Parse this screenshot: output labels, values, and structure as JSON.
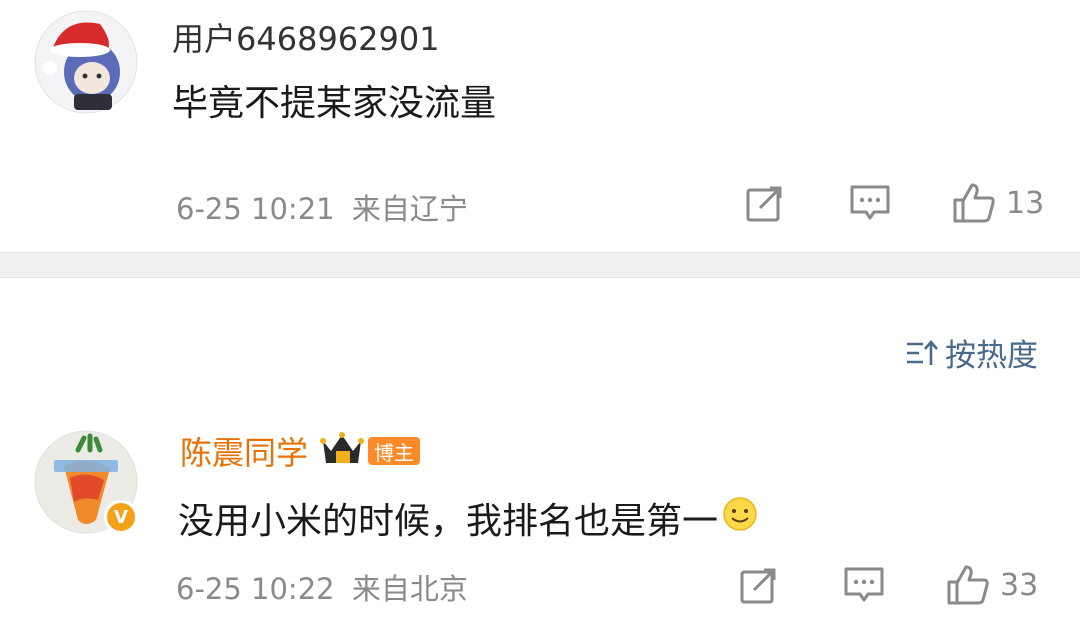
{
  "comments": [
    {
      "username": "用户6468962901",
      "content": "毕竟不提某家没流量",
      "timestamp": "6-25 10:21",
      "location": "来自辽宁",
      "likes": "13",
      "avatar_icon": "anime-avatar-santa-hat"
    },
    {
      "username": "陈震同学",
      "badge": "博主",
      "content": "没用小米的时候，我排名也是第一",
      "emoji": "smile-emoji",
      "timestamp": "6-25 10:22",
      "location": "来自北京",
      "likes": "33",
      "avatar_icon": "carrot-avatar",
      "verified_badge": "V"
    }
  ],
  "sort": {
    "label": "按热度"
  },
  "colors": {
    "verified_name": "#e8710a",
    "badge_bg": "#ff8a2a",
    "sort_text": "#4a6a8a",
    "meta_text": "#8a8a8a",
    "separator": "#f0f0f0"
  }
}
